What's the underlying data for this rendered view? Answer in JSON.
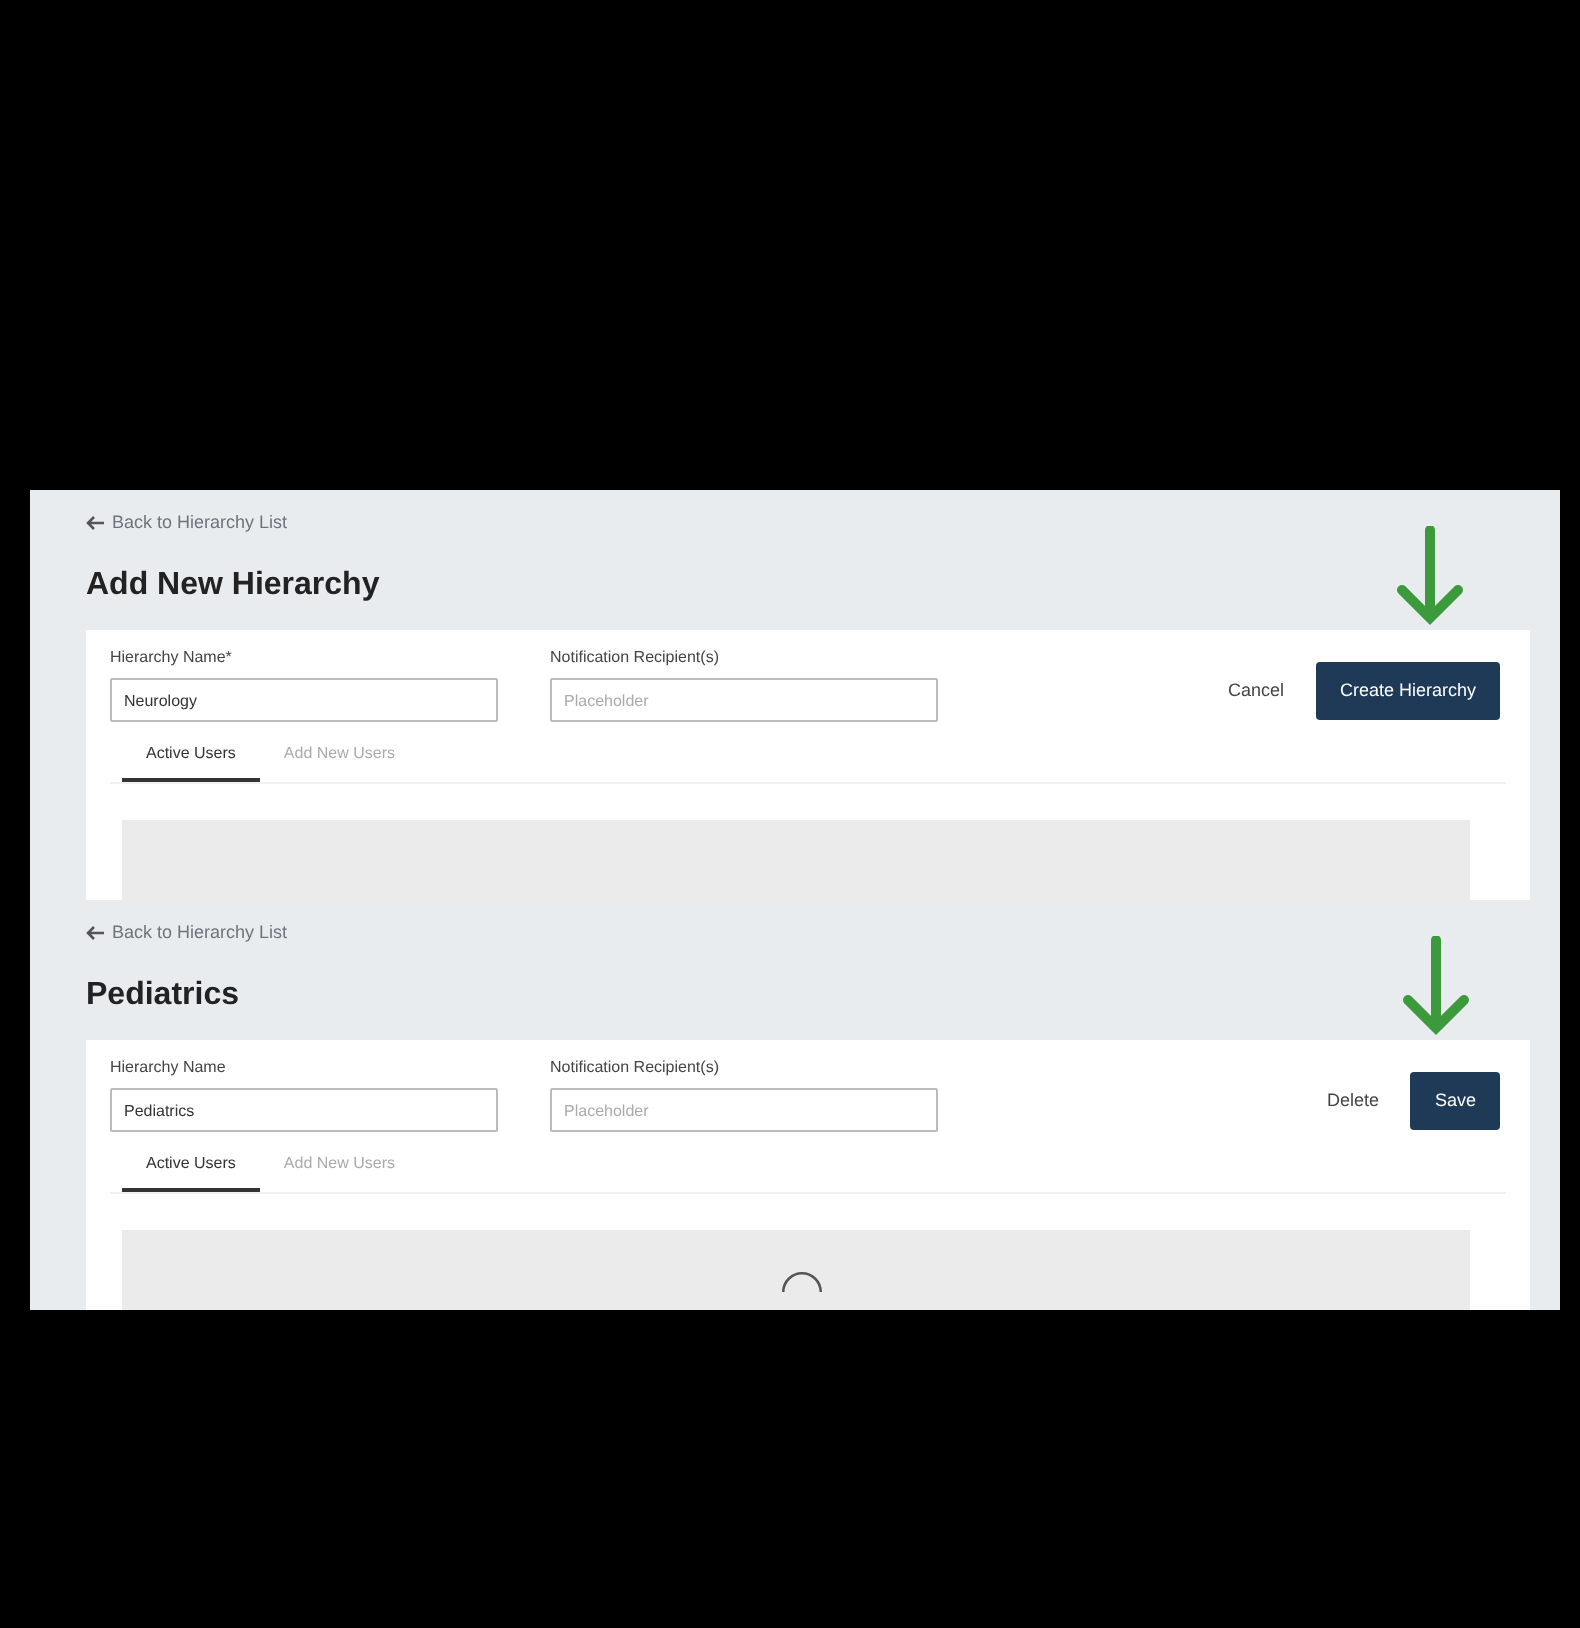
{
  "panels": [
    {
      "back_link": "Back to Hierarchy List",
      "title": "Add New Hierarchy",
      "fields": [
        {
          "label": "Hierarchy Name*",
          "value": "Neurology"
        },
        {
          "label": "Notification Recipient(s)",
          "placeholder": "Placeholder"
        }
      ],
      "actions": [
        {
          "label": "Cancel",
          "kind": "link"
        },
        {
          "label": "Create Hierarchy",
          "kind": "primary"
        }
      ],
      "tabs": [
        {
          "label": "Active Users",
          "selected": true
        },
        {
          "label": "Add New Users",
          "selected": false
        }
      ],
      "loading": false
    },
    {
      "back_link": "Back to Hierarchy List",
      "title": "Pediatrics",
      "fields": [
        {
          "label": "Hierarchy Name",
          "value": "Pediatrics"
        },
        {
          "label": "Notification Recipient(s)",
          "placeholder": "Placeholder"
        }
      ],
      "actions": [
        {
          "label": "Delete",
          "kind": "link"
        },
        {
          "label": "Save",
          "kind": "primary"
        }
      ],
      "tabs": [
        {
          "label": "Active Users",
          "selected": true
        },
        {
          "label": "Add New Users",
          "selected": false
        }
      ],
      "loading": true
    }
  ]
}
